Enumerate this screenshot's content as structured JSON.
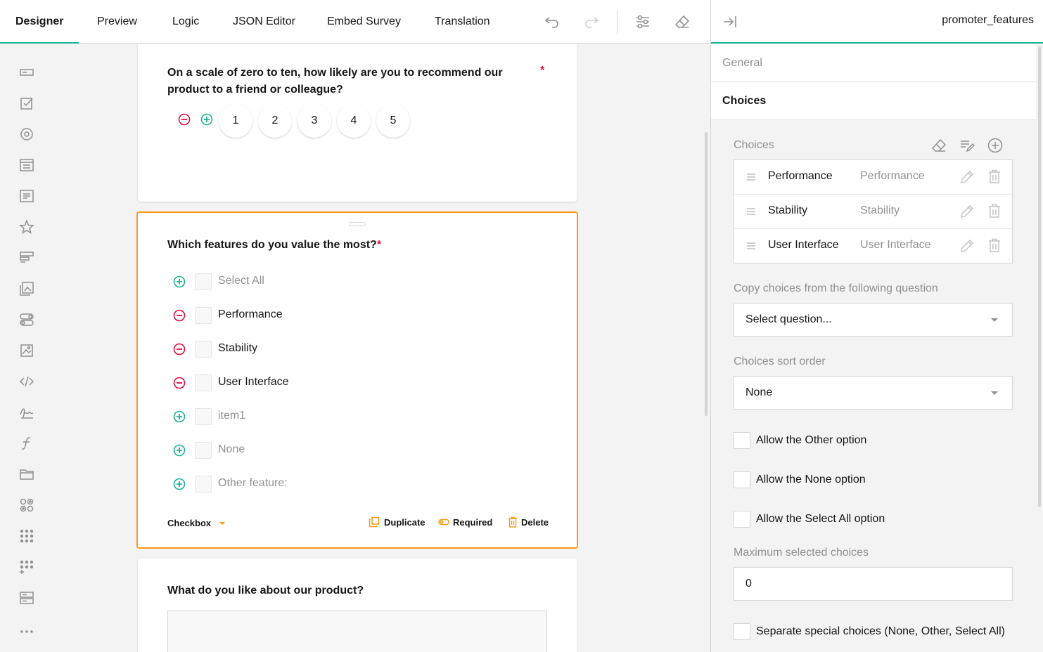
{
  "tabs": [
    {
      "label": "Designer",
      "active": true
    },
    {
      "label": "Preview"
    },
    {
      "label": "Logic"
    },
    {
      "label": "JSON Editor"
    },
    {
      "label": "Embed Survey"
    },
    {
      "label": "Translation"
    }
  ],
  "toolbar_icons": [
    "undo-icon",
    "redo-icon",
    "settings-sliders-icon",
    "eraser-icon"
  ],
  "toolbox_icons": [
    "text-input-icon",
    "checkbox-icon",
    "radiogroup-icon",
    "dropdown-icon",
    "comment-icon",
    "rating-icon",
    "ranking-icon",
    "imagepicker-icon",
    "boolean-icon",
    "image-icon",
    "html-icon",
    "signature-icon",
    "expression-icon",
    "file-icon",
    "matrix-icon",
    "matrix-dropdown-icon",
    "matrix-dynamic-icon",
    "multiple-text-icon",
    "more-icon"
  ],
  "q1": {
    "title": "On a scale of zero to ten, how likely are you to recommend our product to a friend or colleague?",
    "required_mark": "*",
    "rates": [
      "1",
      "2",
      "3",
      "4",
      "5"
    ]
  },
  "q2": {
    "title": "Which features do you value the most?",
    "required_mark": "*",
    "items": [
      {
        "label": "Select All",
        "ghost": true
      },
      {
        "label": "Performance",
        "ghost": false
      },
      {
        "label": "Stability",
        "ghost": false
      },
      {
        "label": "User Interface",
        "ghost": false
      },
      {
        "label": "item1",
        "ghost": true
      },
      {
        "label": "None",
        "ghost": true
      },
      {
        "label": "Other feature:",
        "ghost": true
      }
    ],
    "type_label": "Checkbox",
    "actions": {
      "duplicate": "Duplicate",
      "required": "Required",
      "delete": "Delete"
    }
  },
  "q3": {
    "title": "What do you like about our product?"
  },
  "panel": {
    "title": "promoter_features",
    "tabs": {
      "general": "General",
      "choices": "Choices"
    },
    "choices_label": "Choices",
    "choices": [
      {
        "value": "Performance",
        "text": "Performance"
      },
      {
        "value": "Stability",
        "text": "Stability"
      },
      {
        "value": "User Interface",
        "text": "User Interface"
      }
    ],
    "copy_label": "Copy choices from the following question",
    "copy_value": "Select question...",
    "sort_label": "Choices sort order",
    "sort_value": "None",
    "allow_other": "Allow the Other option",
    "allow_none": "Allow the None option",
    "allow_select_all": "Allow the Select All option",
    "max_label": "Maximum selected choices",
    "max_value": "0",
    "separate_special": "Separate special choices (None, Other, Select All)"
  },
  "colors": {
    "accent": "#19b394",
    "selected": "#ff9814",
    "required": "#e60a3e",
    "remove": "#e60a3e",
    "add": "#19b394"
  }
}
